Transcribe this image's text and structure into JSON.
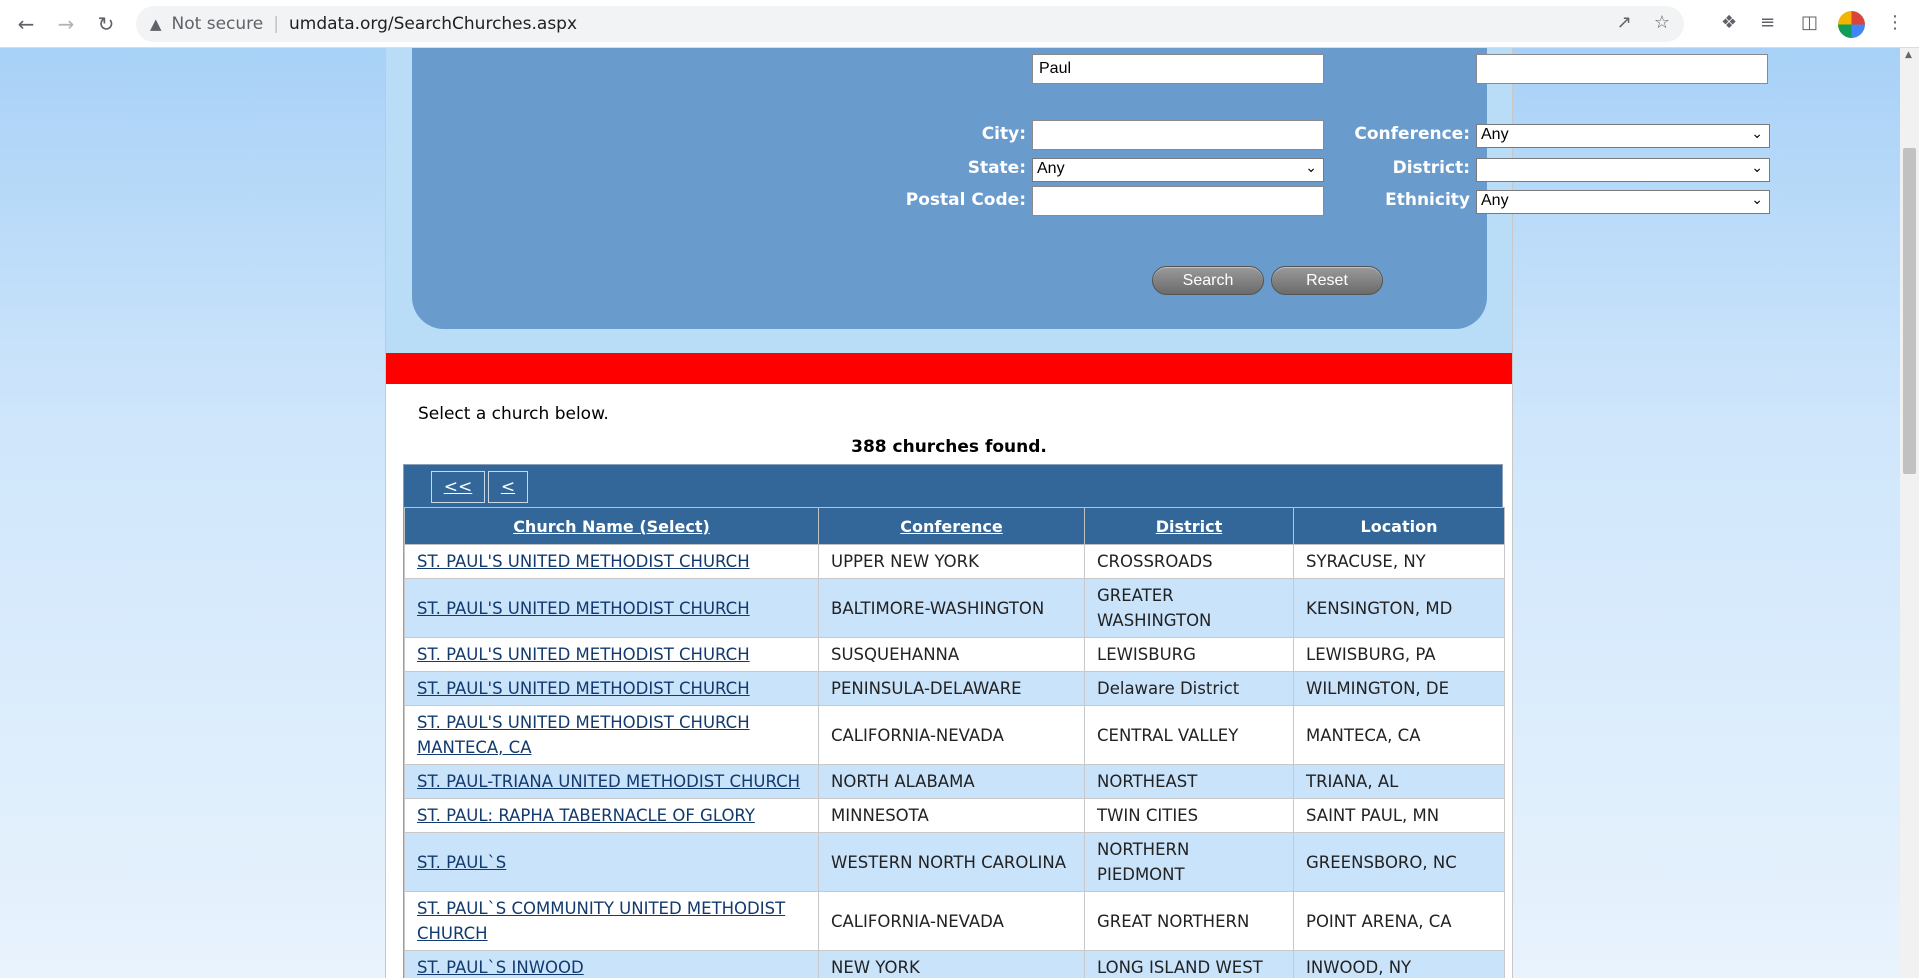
{
  "browser": {
    "security_label": "Not secure",
    "url": "umdata.org/SearchChurches.aspx"
  },
  "form": {
    "name_value": "Paul",
    "other_value": "",
    "city_label": "City:",
    "city_value": "",
    "state_label": "State:",
    "state_value": "Any",
    "postal_label": "Postal Code:",
    "postal_value": "",
    "conference_label": "Conference:",
    "conference_value": "Any",
    "district_label": "District:",
    "district_value": "",
    "ethnicity_label": "Ethnicity",
    "ethnicity_value": "Any",
    "search_button": "Search",
    "reset_button": "Reset"
  },
  "results": {
    "instruction": "Select a church below.",
    "count": "388 churches found.",
    "pager_first": "<<",
    "pager_prev": "<",
    "headers": [
      "Church Name (Select)",
      "Conference",
      "District",
      "Location"
    ],
    "rows": [
      {
        "name": "ST. PAUL'S UNITED METHODIST CHURCH",
        "conference": "UPPER NEW YORK",
        "district": "CROSSROADS",
        "location": "SYRACUSE, NY"
      },
      {
        "name": "ST. PAUL'S UNITED METHODIST CHURCH",
        "conference": "BALTIMORE-WASHINGTON",
        "district": "GREATER WASHINGTON",
        "location": "KENSINGTON, MD"
      },
      {
        "name": "ST. PAUL'S UNITED METHODIST CHURCH",
        "conference": "SUSQUEHANNA",
        "district": "LEWISBURG",
        "location": "LEWISBURG, PA"
      },
      {
        "name": "ST. PAUL'S UNITED METHODIST CHURCH",
        "conference": "PENINSULA-DELAWARE",
        "district": "Delaware District",
        "location": "WILMINGTON, DE"
      },
      {
        "name": "ST. PAUL'S UNITED METHODIST CHURCH MANTECA, CA",
        "conference": "CALIFORNIA-NEVADA",
        "district": "CENTRAL VALLEY",
        "location": "MANTECA, CA"
      },
      {
        "name": "ST. PAUL-TRIANA UNITED METHODIST CHURCH",
        "conference": "NORTH ALABAMA",
        "district": "NORTHEAST",
        "location": "TRIANA, AL"
      },
      {
        "name": "ST. PAUL: RAPHA TABERNACLE OF GLORY",
        "conference": "MINNESOTA",
        "district": "TWIN CITIES",
        "location": "SAINT PAUL, MN"
      },
      {
        "name": "ST. PAUL`S",
        "conference": "WESTERN NORTH CAROLINA",
        "district": "NORTHERN PIEDMONT",
        "location": "GREENSBORO, NC"
      },
      {
        "name": "ST. PAUL`S COMMUNITY UNITED METHODIST CHURCH",
        "conference": "CALIFORNIA-NEVADA",
        "district": "GREAT NORTHERN",
        "location": "POINT ARENA, CA"
      },
      {
        "name": "ST. PAUL`S INWOOD",
        "conference": "NEW YORK",
        "district": "LONG ISLAND WEST",
        "location": "INWOOD, NY"
      }
    ]
  }
}
